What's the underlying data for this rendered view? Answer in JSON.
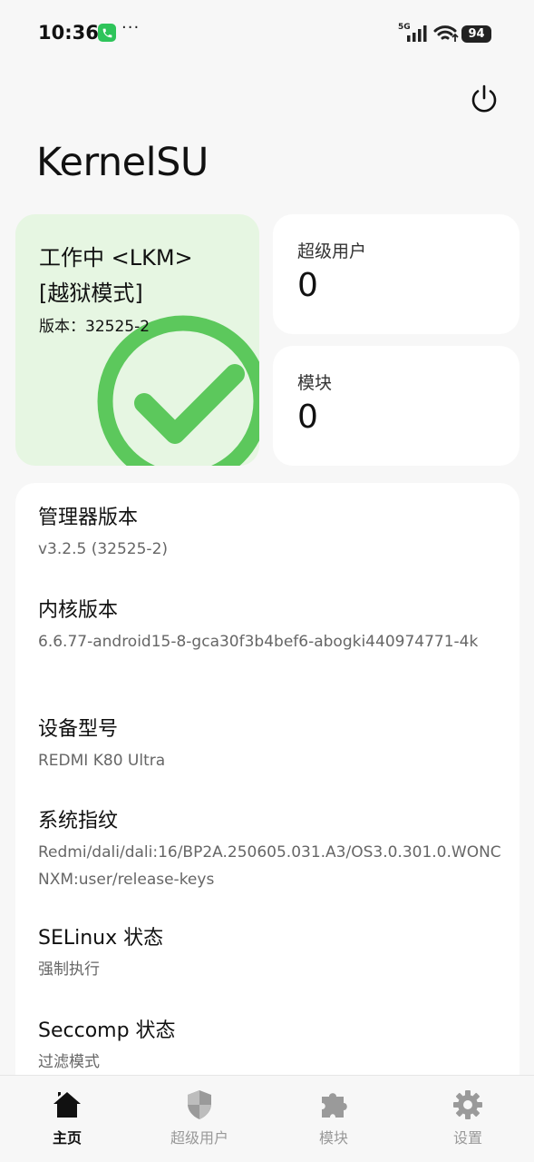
{
  "status_bar": {
    "time": "10:36",
    "dots": "···",
    "network": "5G",
    "battery": "94"
  },
  "header": {
    "title": "KernelSU"
  },
  "status_card": {
    "line1": "工作中 <LKM>",
    "line2": "[越狱模式]",
    "version": "版本：32525-2",
    "accent": "#5cc85c"
  },
  "superuser_card": {
    "label": "超级用户",
    "count": "0"
  },
  "module_card": {
    "label": "模块",
    "count": "0"
  },
  "info": [
    {
      "title": "管理器版本",
      "value": "v3.2.5 (32525-2)"
    },
    {
      "title": "内核版本",
      "value": "6.6.77-android15-8-gca30f3b4bef6-abogki440974771-4k"
    },
    {
      "title": "设备型号",
      "value": "REDMI K80 Ultra"
    },
    {
      "title": "系统指纹",
      "value": "Redmi/dali/dali:16/BP2A.250605.031.A3/OS3.0.301.0.WONCNXM:user/release-keys"
    },
    {
      "title": "SELinux 状态",
      "value": "强制执行"
    },
    {
      "title": "Seccomp 状态",
      "value": "过滤模式"
    }
  ],
  "bottom_nav": [
    {
      "label": "主页",
      "icon": "home-icon",
      "active": true
    },
    {
      "label": "超级用户",
      "icon": "shield-icon",
      "active": false
    },
    {
      "label": "模块",
      "icon": "puzzle-icon",
      "active": false
    },
    {
      "label": "设置",
      "icon": "gear-icon",
      "active": false
    }
  ]
}
